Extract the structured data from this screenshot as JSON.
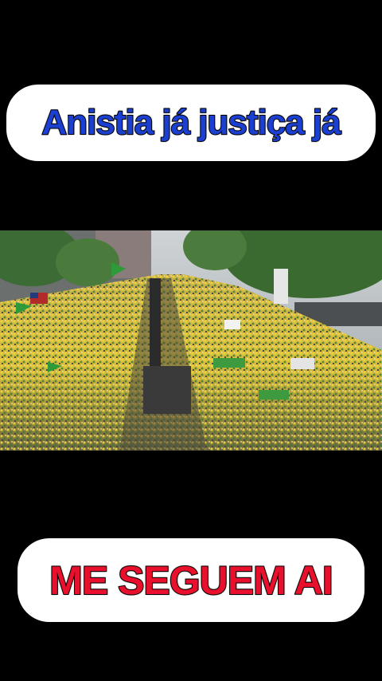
{
  "top_caption": {
    "text": "Anistia já justiça já",
    "color": "#1b3fd0"
  },
  "bottom_caption": {
    "text": "ME SEGUEM AI",
    "color": "#e8102c"
  },
  "photo": {
    "subject": "aerial-crowd-street-protest",
    "dominant_colors": [
      "#e2c83a",
      "#2f8a3a",
      "#3a3a3a"
    ]
  }
}
